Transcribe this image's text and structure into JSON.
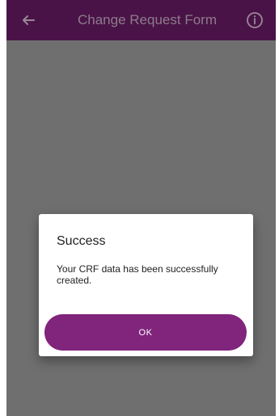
{
  "app_bar": {
    "title": "Change Request Form",
    "back_icon": "arrow-left-icon",
    "info_icon": "info-icon",
    "color": "#4a1347"
  },
  "overlay": {
    "color": "#6f6f6f"
  },
  "dialog": {
    "title": "Success",
    "message": "Your CRF data has been successfully created.",
    "ok_label": "OK",
    "button_color": "#80247c"
  }
}
